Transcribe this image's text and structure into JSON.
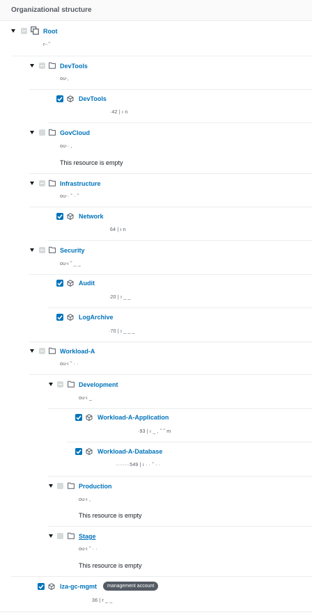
{
  "header": {
    "title": "Organizational structure"
  },
  "tree": {
    "root": {
      "label": "Root",
      "id": "r-·˜"
    },
    "devtools_ou": {
      "label": "DevTools",
      "id": "ou-,"
    },
    "devtools_account": {
      "label": "DevTools",
      "details": "·42  |  ı                                                          n"
    },
    "govcloud_ou": {
      "label": "GovCloud",
      "id": "ou-·        ,",
      "empty_text": "This resource is empty"
    },
    "infrastructure_ou": {
      "label": "Infrastructure",
      "id": "ou-·    ˜    ·    ˜"
    },
    "network_account": {
      "label": "Network",
      "details": "64  |  ı                                                          n"
    },
    "security_ou": {
      "label": "Security",
      "id": "ou-ı         ˜  _ _"
    },
    "audit_account": {
      "label": "Audit",
      "details": "·20  |  ı                         _         _"
    },
    "logarchive_account": {
      "label": "LogArchive",
      "details": "·70  |  ı                         _    _ _"
    },
    "workload_a_ou": {
      "label": "Workload-A",
      "id": "ou-ı    ˜ ·     ·"
    },
    "development_ou": {
      "label": "Development",
      "id": "ou-ı         _"
    },
    "workload_a_application_account": {
      "label": "Workload-A-Application",
      "details": "·93  |  ı                   _                 ,  ˜              ˜                   m"
    },
    "workload_a_database_account": {
      "label": "Workload-A-Database",
      "details": "········549  |  ı ·  ·              ˜    · ·"
    },
    "production_ou": {
      "label": "Production",
      "id": "ou-ı         ,",
      "empty_text": "This resource is empty"
    },
    "stage_ou": {
      "label": "Stage",
      "id": "ou-ı   ˜  ·   ·",
      "empty_text": "This resource is empty"
    },
    "mgmt_account": {
      "label": "lza-gc-mgmt",
      "badge": "management account",
      "details": "36  |  r                    _       _"
    }
  }
}
